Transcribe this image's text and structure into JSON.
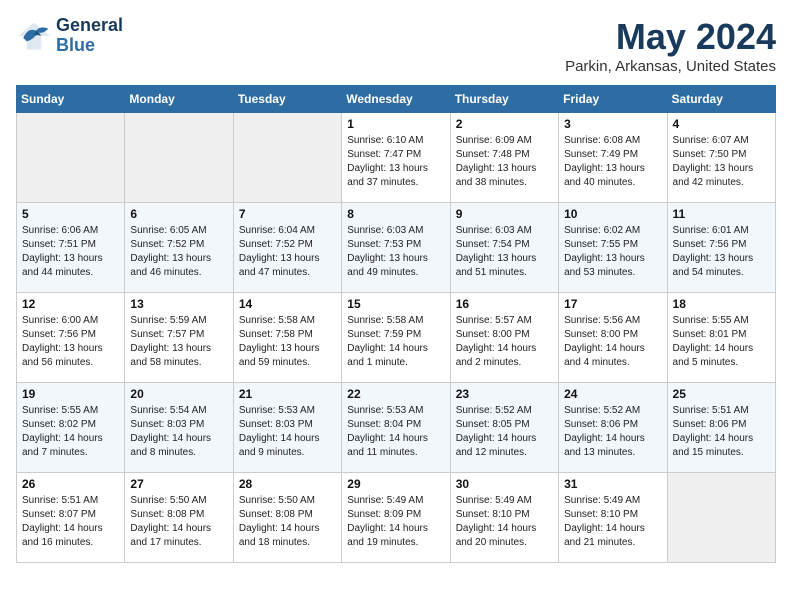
{
  "header": {
    "logo_line1": "General",
    "logo_line2": "Blue",
    "title": "May 2024",
    "subtitle": "Parkin, Arkansas, United States"
  },
  "days_of_week": [
    "Sunday",
    "Monday",
    "Tuesday",
    "Wednesday",
    "Thursday",
    "Friday",
    "Saturday"
  ],
  "weeks": [
    [
      {
        "day": "",
        "empty": true
      },
      {
        "day": "",
        "empty": true
      },
      {
        "day": "",
        "empty": true
      },
      {
        "day": "1",
        "sunrise": "6:10 AM",
        "sunset": "7:47 PM",
        "daylight": "13 hours and 37 minutes."
      },
      {
        "day": "2",
        "sunrise": "6:09 AM",
        "sunset": "7:48 PM",
        "daylight": "13 hours and 38 minutes."
      },
      {
        "day": "3",
        "sunrise": "6:08 AM",
        "sunset": "7:49 PM",
        "daylight": "13 hours and 40 minutes."
      },
      {
        "day": "4",
        "sunrise": "6:07 AM",
        "sunset": "7:50 PM",
        "daylight": "13 hours and 42 minutes."
      }
    ],
    [
      {
        "day": "5",
        "sunrise": "6:06 AM",
        "sunset": "7:51 PM",
        "daylight": "13 hours and 44 minutes."
      },
      {
        "day": "6",
        "sunrise": "6:05 AM",
        "sunset": "7:52 PM",
        "daylight": "13 hours and 46 minutes."
      },
      {
        "day": "7",
        "sunrise": "6:04 AM",
        "sunset": "7:52 PM",
        "daylight": "13 hours and 47 minutes."
      },
      {
        "day": "8",
        "sunrise": "6:03 AM",
        "sunset": "7:53 PM",
        "daylight": "13 hours and 49 minutes."
      },
      {
        "day": "9",
        "sunrise": "6:03 AM",
        "sunset": "7:54 PM",
        "daylight": "13 hours and 51 minutes."
      },
      {
        "day": "10",
        "sunrise": "6:02 AM",
        "sunset": "7:55 PM",
        "daylight": "13 hours and 53 minutes."
      },
      {
        "day": "11",
        "sunrise": "6:01 AM",
        "sunset": "7:56 PM",
        "daylight": "13 hours and 54 minutes."
      }
    ],
    [
      {
        "day": "12",
        "sunrise": "6:00 AM",
        "sunset": "7:56 PM",
        "daylight": "13 hours and 56 minutes."
      },
      {
        "day": "13",
        "sunrise": "5:59 AM",
        "sunset": "7:57 PM",
        "daylight": "13 hours and 58 minutes."
      },
      {
        "day": "14",
        "sunrise": "5:58 AM",
        "sunset": "7:58 PM",
        "daylight": "13 hours and 59 minutes."
      },
      {
        "day": "15",
        "sunrise": "5:58 AM",
        "sunset": "7:59 PM",
        "daylight": "14 hours and 1 minute."
      },
      {
        "day": "16",
        "sunrise": "5:57 AM",
        "sunset": "8:00 PM",
        "daylight": "14 hours and 2 minutes."
      },
      {
        "day": "17",
        "sunrise": "5:56 AM",
        "sunset": "8:00 PM",
        "daylight": "14 hours and 4 minutes."
      },
      {
        "day": "18",
        "sunrise": "5:55 AM",
        "sunset": "8:01 PM",
        "daylight": "14 hours and 5 minutes."
      }
    ],
    [
      {
        "day": "19",
        "sunrise": "5:55 AM",
        "sunset": "8:02 PM",
        "daylight": "14 hours and 7 minutes."
      },
      {
        "day": "20",
        "sunrise": "5:54 AM",
        "sunset": "8:03 PM",
        "daylight": "14 hours and 8 minutes."
      },
      {
        "day": "21",
        "sunrise": "5:53 AM",
        "sunset": "8:03 PM",
        "daylight": "14 hours and 9 minutes."
      },
      {
        "day": "22",
        "sunrise": "5:53 AM",
        "sunset": "8:04 PM",
        "daylight": "14 hours and 11 minutes."
      },
      {
        "day": "23",
        "sunrise": "5:52 AM",
        "sunset": "8:05 PM",
        "daylight": "14 hours and 12 minutes."
      },
      {
        "day": "24",
        "sunrise": "5:52 AM",
        "sunset": "8:06 PM",
        "daylight": "14 hours and 13 minutes."
      },
      {
        "day": "25",
        "sunrise": "5:51 AM",
        "sunset": "8:06 PM",
        "daylight": "14 hours and 15 minutes."
      }
    ],
    [
      {
        "day": "26",
        "sunrise": "5:51 AM",
        "sunset": "8:07 PM",
        "daylight": "14 hours and 16 minutes."
      },
      {
        "day": "27",
        "sunrise": "5:50 AM",
        "sunset": "8:08 PM",
        "daylight": "14 hours and 17 minutes."
      },
      {
        "day": "28",
        "sunrise": "5:50 AM",
        "sunset": "8:08 PM",
        "daylight": "14 hours and 18 minutes."
      },
      {
        "day": "29",
        "sunrise": "5:49 AM",
        "sunset": "8:09 PM",
        "daylight": "14 hours and 19 minutes."
      },
      {
        "day": "30",
        "sunrise": "5:49 AM",
        "sunset": "8:10 PM",
        "daylight": "14 hours and 20 minutes."
      },
      {
        "day": "31",
        "sunrise": "5:49 AM",
        "sunset": "8:10 PM",
        "daylight": "14 hours and 21 minutes."
      },
      {
        "day": "",
        "empty": true
      }
    ]
  ]
}
